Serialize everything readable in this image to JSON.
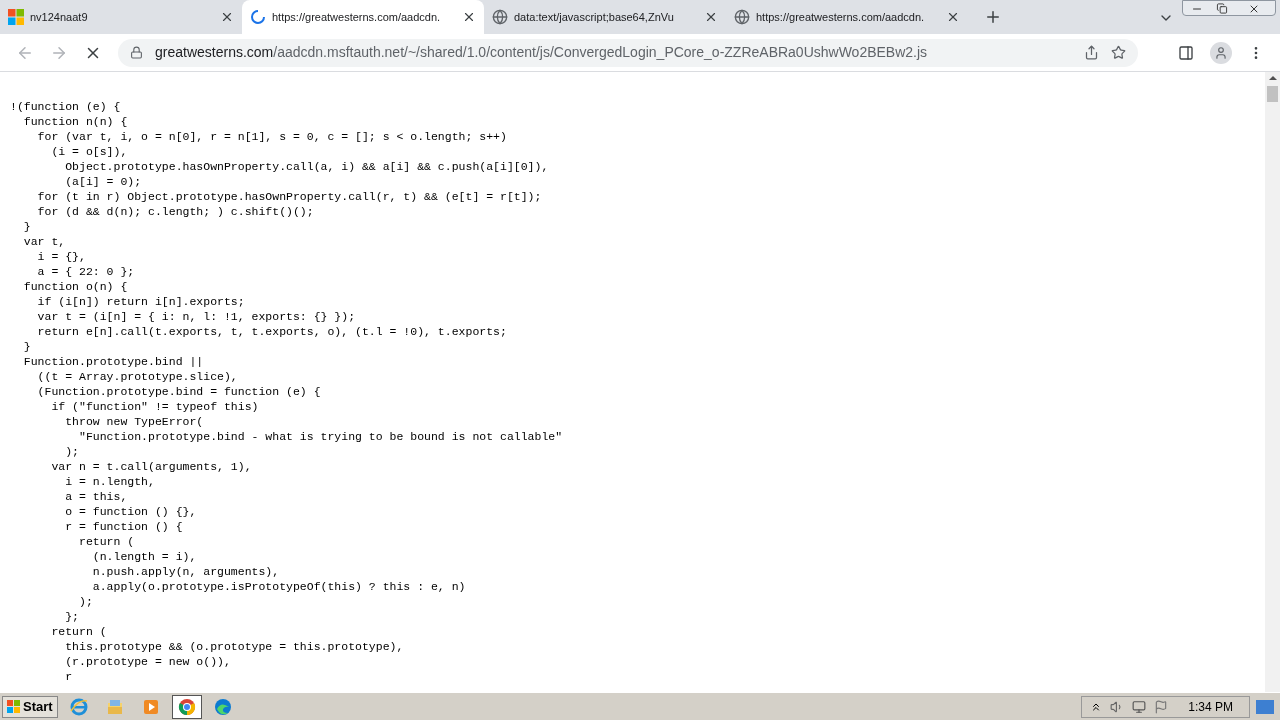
{
  "tabs": [
    {
      "title": "nv124naat9",
      "kind": "windows",
      "selected": false
    },
    {
      "title": "https://greatwesterns.com/aadcdn.",
      "kind": "spinner",
      "selected": true
    },
    {
      "title": "data:text/javascript;base64,ZnVu",
      "kind": "globe",
      "selected": false
    },
    {
      "title": "https://greatwesterns.com/aadcdn.",
      "kind": "globe",
      "selected": false
    }
  ],
  "address_bar": {
    "host": "greatwesterns.com",
    "path": "/aadcdn.msftauth.net/~/shared/1.0/content/js/ConvergedLogin_PCore_o-ZZReABRa0UshwWo2BEBw2.js",
    "loading": true
  },
  "code_lines": [
    "!(function (e) {",
    "  function n(n) {",
    "    for (var t, i, o = n[0], r = n[1], s = 0, c = []; s < o.length; s++)",
    "      (i = o[s]),",
    "        Object.prototype.hasOwnProperty.call(a, i) && a[i] && c.push(a[i][0]),",
    "        (a[i] = 0);",
    "    for (t in r) Object.prototype.hasOwnProperty.call(r, t) && (e[t] = r[t]);",
    "    for (d && d(n); c.length; ) c.shift()();",
    "  }",
    "  var t,",
    "    i = {},",
    "    a = { 22: 0 };",
    "  function o(n) {",
    "    if (i[n]) return i[n].exports;",
    "    var t = (i[n] = { i: n, l: !1, exports: {} });",
    "    return e[n].call(t.exports, t, t.exports, o), (t.l = !0), t.exports;",
    "  }",
    "  Function.prototype.bind ||",
    "    ((t = Array.prototype.slice),",
    "    (Function.prototype.bind = function (e) {",
    "      if (\"function\" != typeof this)",
    "        throw new TypeError(",
    "          \"Function.prototype.bind - what is trying to be bound is not callable\"",
    "        );",
    "      var n = t.call(arguments, 1),",
    "        i = n.length,",
    "        a = this,",
    "        o = function () {},",
    "        r = function () {",
    "          return (",
    "            (n.length = i),",
    "            n.push.apply(n, arguments),",
    "            a.apply(o.prototype.isPrototypeOf(this) ? this : e, n)",
    "          );",
    "        };",
    "      return (",
    "        this.prototype && (o.prototype = this.prototype),",
    "        (r.prototype = new o()),",
    "        r"
  ],
  "taskbar": {
    "start": "Start",
    "apps": [
      {
        "kind": "ie",
        "selected": false
      },
      {
        "kind": "folder",
        "selected": false
      },
      {
        "kind": "media",
        "selected": false
      },
      {
        "kind": "chrome",
        "selected": true
      },
      {
        "kind": "edge",
        "selected": false
      }
    ],
    "clock": "1:34 PM"
  }
}
